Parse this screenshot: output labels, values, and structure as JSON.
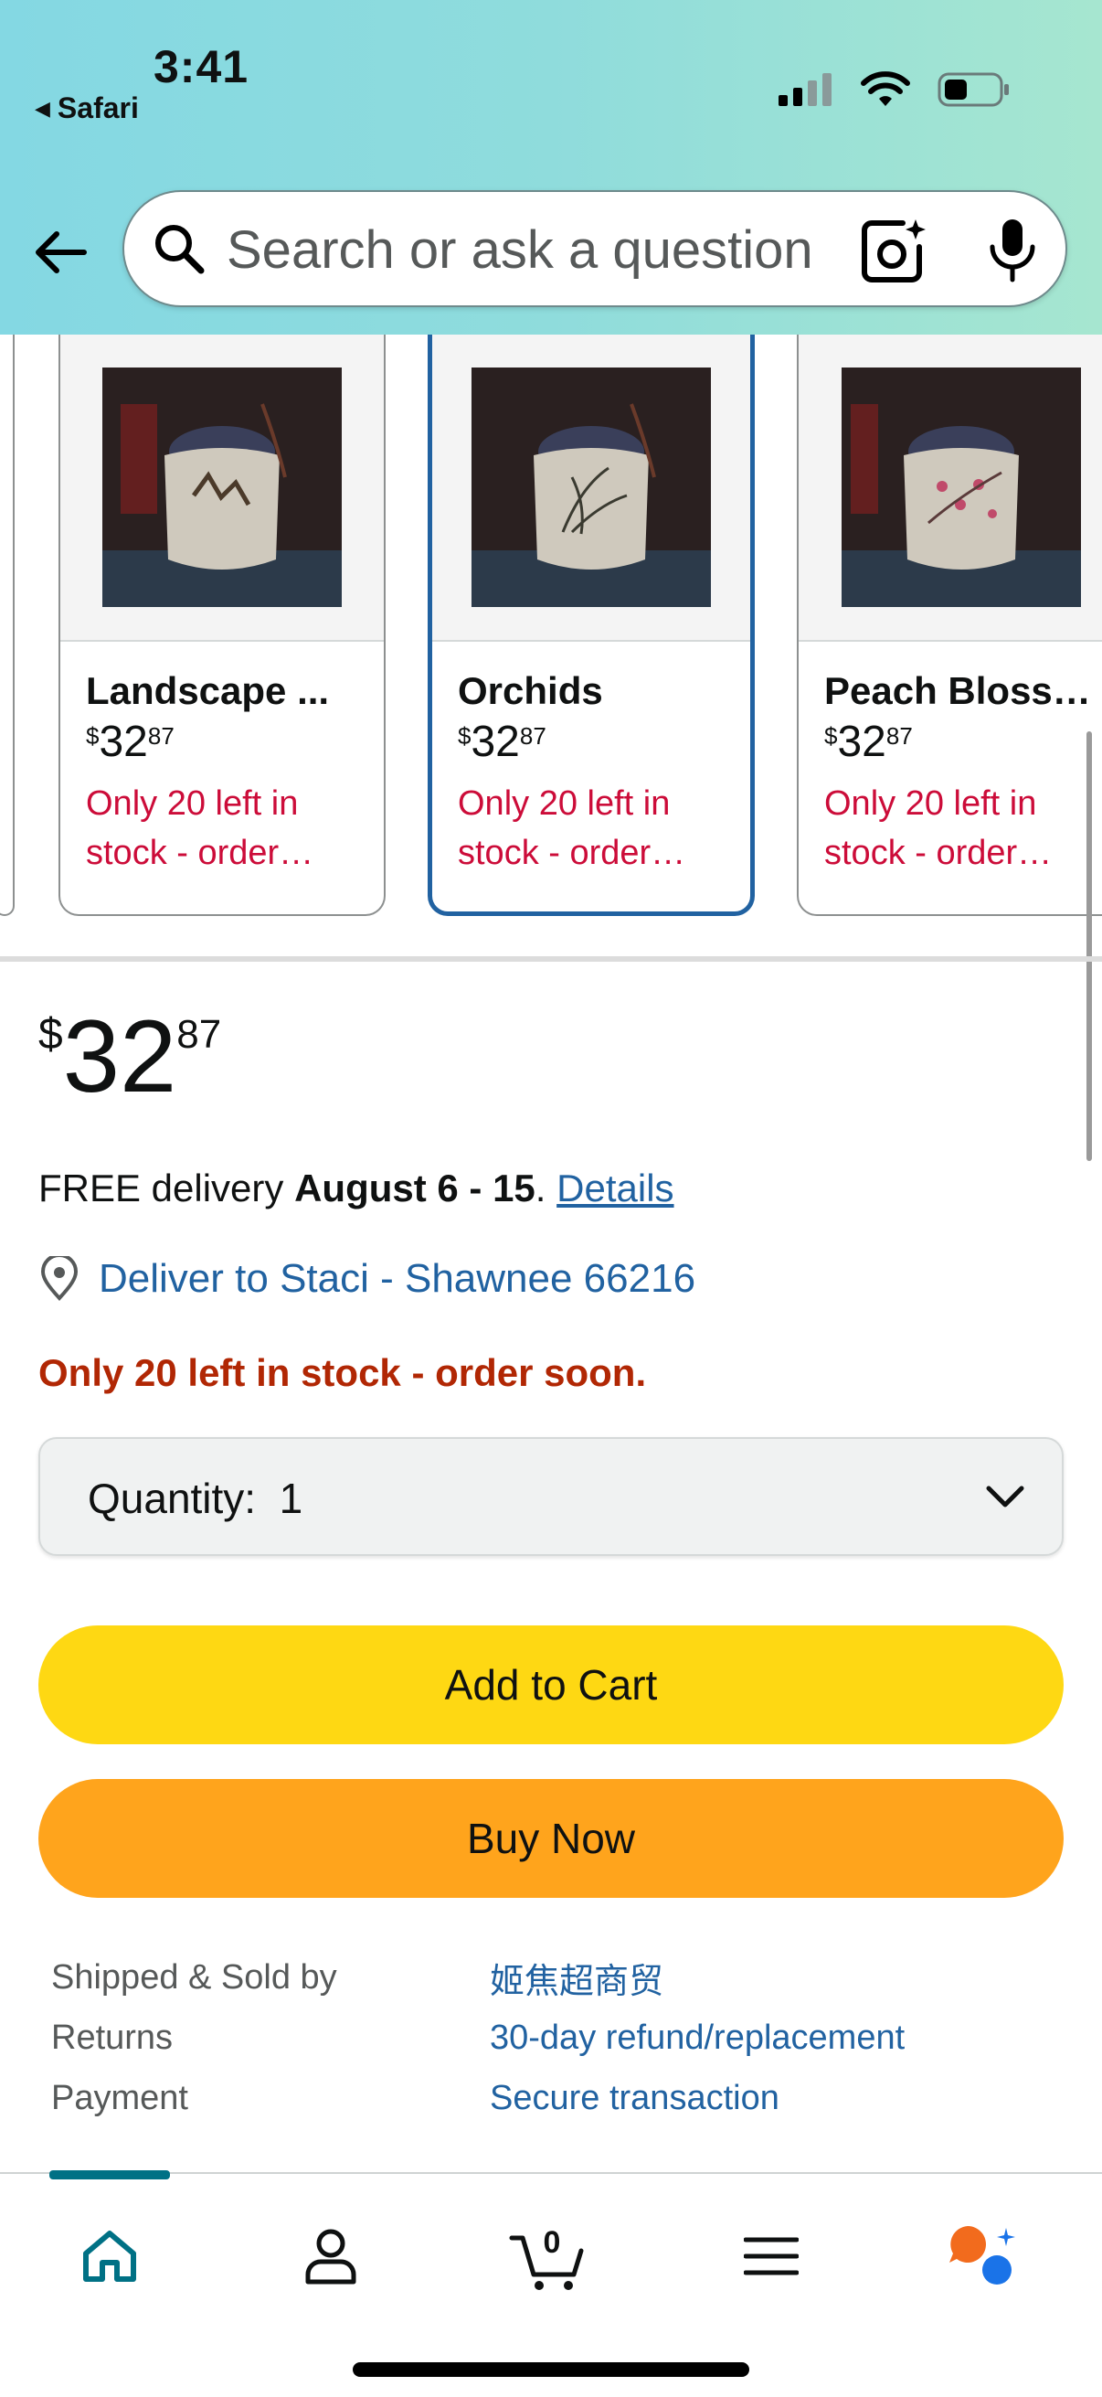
{
  "status_bar": {
    "time": "3:41",
    "back_app": "Safari"
  },
  "search": {
    "placeholder": "Search or ask a question"
  },
  "icons": {
    "back": "back-arrow-icon",
    "search": "search-icon",
    "camera": "camera-lens-icon",
    "mic": "microphone-icon",
    "location": "location-pin-icon",
    "chevron": "chevron-down-icon",
    "home": "home-icon",
    "account": "person-icon",
    "cart": "cart-icon",
    "menu": "menu-icon",
    "rufus": "rufus-chat-icon"
  },
  "variants": [
    {
      "name": "Landscape ...",
      "price_whole": "32",
      "price_fraction": "87",
      "price_symbol": "$",
      "stock": "Only 20 left in stock - order…",
      "selected": false
    },
    {
      "name": "Orchids",
      "price_whole": "32",
      "price_fraction": "87",
      "price_symbol": "$",
      "stock": "Only 20 left in stock - order…",
      "selected": true
    },
    {
      "name": "Peach Bloss…",
      "price_whole": "32",
      "price_fraction": "87",
      "price_symbol": "$",
      "stock": "Only 20 left in stock - order…",
      "selected": false
    }
  ],
  "price": {
    "symbol": "$",
    "whole": "32",
    "fraction": "87"
  },
  "delivery": {
    "prefix": "FREE delivery ",
    "dates": "August 6 - 15",
    "suffix": ". ",
    "details_link": "Details"
  },
  "deliver_to": "Deliver to Staci - Shawnee 66216",
  "stock_message": "Only 20 left in stock - order soon.",
  "quantity": {
    "label": "Quantity:",
    "value": "1"
  },
  "buttons": {
    "add_to_cart": "Add to Cart",
    "buy_now": "Buy Now"
  },
  "info_rows": [
    {
      "key": "Shipped & Sold by",
      "value": "姬焦超商贸"
    },
    {
      "key": "Returns",
      "value": "30-day refund/replacement"
    },
    {
      "key": "Payment",
      "value": "Secure transaction"
    }
  ],
  "nav": {
    "cart_count": "0",
    "active": "home"
  },
  "colors": {
    "link": "#2162a1",
    "stock_red": "#cc0c39",
    "add_to_cart": "#fed813",
    "buy_now": "#ffa41c",
    "selected_border": "#2162a1",
    "nav_active": "#007185"
  }
}
